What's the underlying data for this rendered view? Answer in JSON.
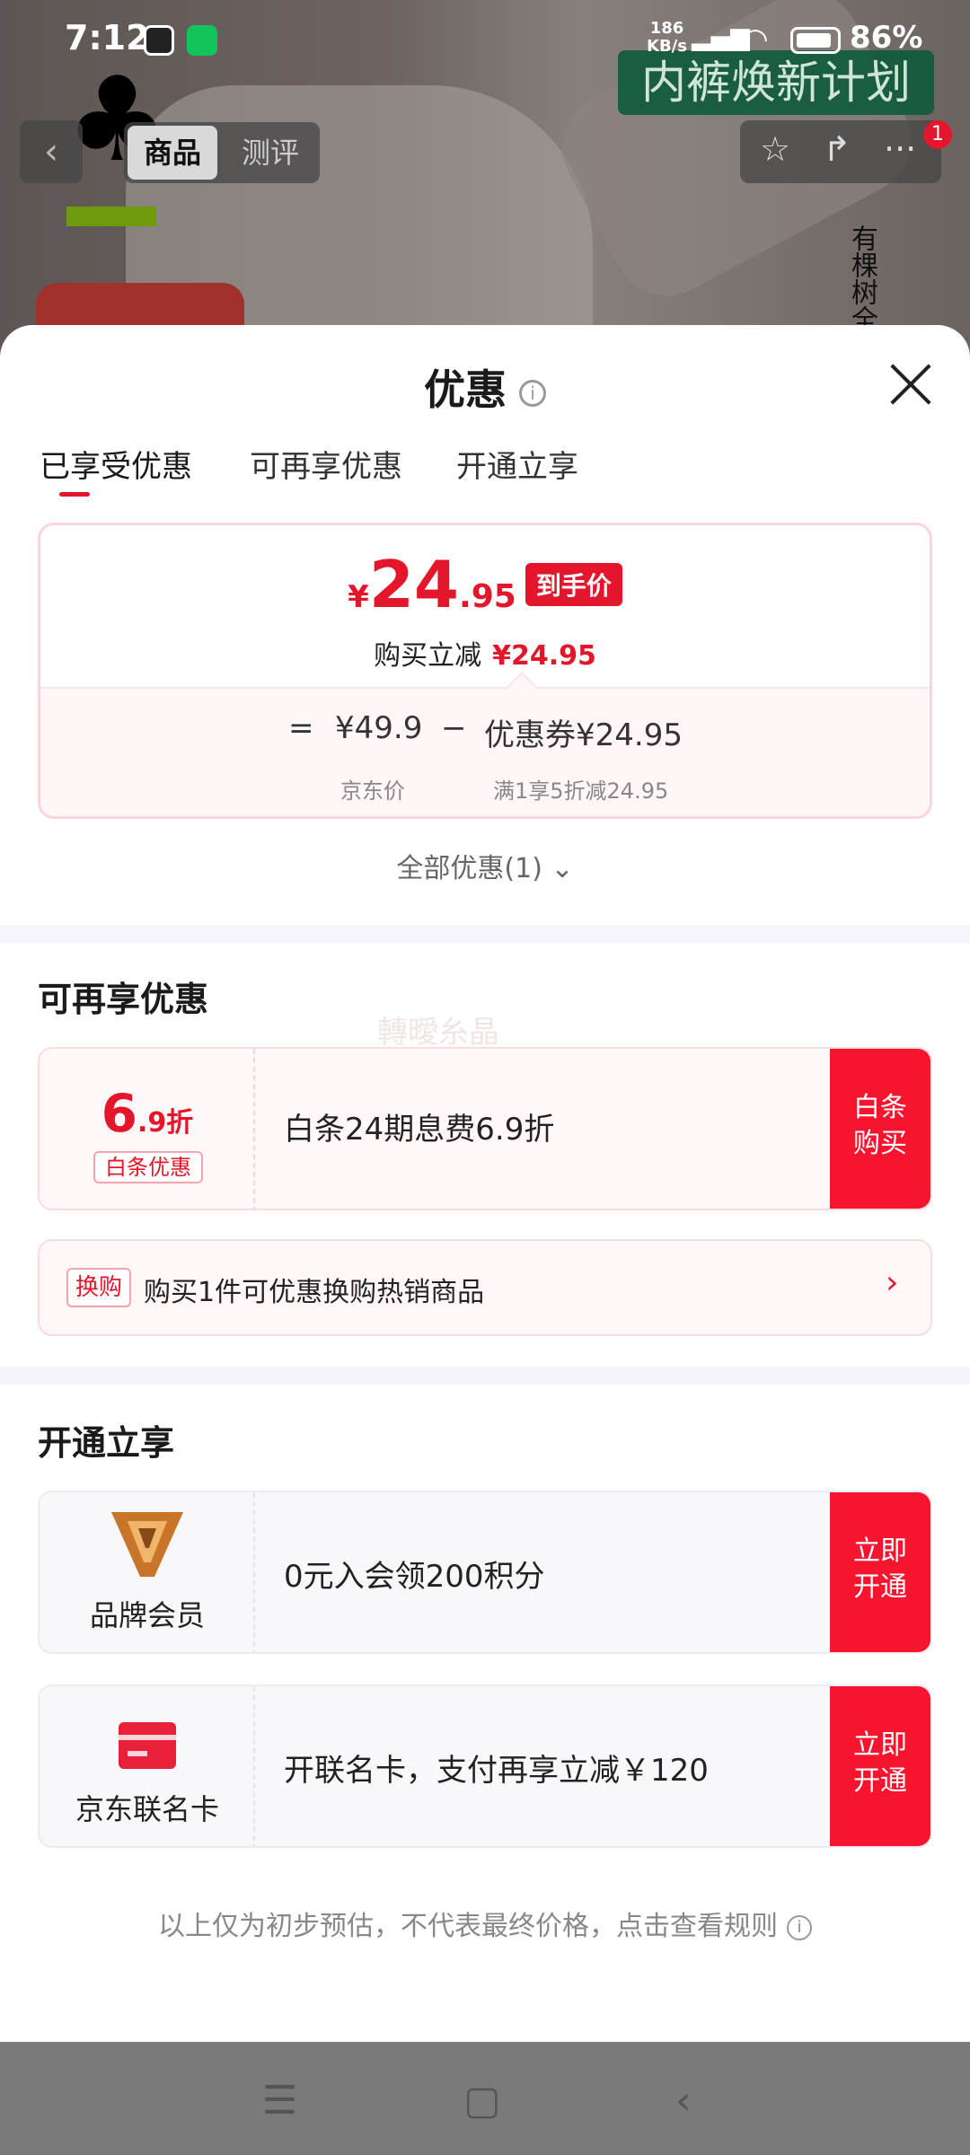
{
  "status_bar": {
    "time": "7:12",
    "net_speed": "186",
    "net_unit": "KB/s",
    "battery": "86%"
  },
  "background": {
    "banner": "内裤焕新计划",
    "tab_goods": "商品",
    "tab_review": "测评",
    "vertical_text": "有棵树全",
    "notification_count": "1"
  },
  "sheet": {
    "title": "优惠",
    "tabs": [
      "已享受优惠",
      "可再享优惠",
      "开通立享"
    ],
    "price": {
      "currency": "¥",
      "integer": "24",
      "decimal": ".95",
      "tag": "到手价",
      "saving_label": "购买立减",
      "saving_value": "¥24.95",
      "equals": "=",
      "original_price": "¥49.9",
      "minus": "−",
      "coupon_label": "优惠券",
      "coupon_value": "¥24.95",
      "original_caption": "京东价",
      "coupon_caption": "满1享5折减24.95"
    },
    "all_offers": "全部优惠(1)",
    "section_more": "可再享优惠",
    "watermark": "轉曖糸晶",
    "baitiao": {
      "discount_num": "6",
      "discount_suffix": ".9折",
      "tag": "白条优惠",
      "text": "白条24期息费6.9折",
      "action_line1": "白条",
      "action_line2": "购买"
    },
    "swap": {
      "tag": "换购",
      "text": "购买1件可优惠换购热销商品"
    },
    "section_open": "开通立享",
    "brand_member": {
      "label": "品牌会员",
      "text": "0元入会领200积分",
      "action_line1": "立即",
      "action_line2": "开通"
    },
    "jd_card": {
      "label": "京东联名卡",
      "text": "开联名卡，支付再享立减￥120",
      "action_line1": "立即",
      "action_line2": "开通"
    },
    "footer_note": "以上仅为初步预估，不代表最终价格，点击查看规则"
  },
  "colors": {
    "accent_red": "#e4162b",
    "action_red": "#f7142f",
    "brand_gold": "#c8752a"
  }
}
